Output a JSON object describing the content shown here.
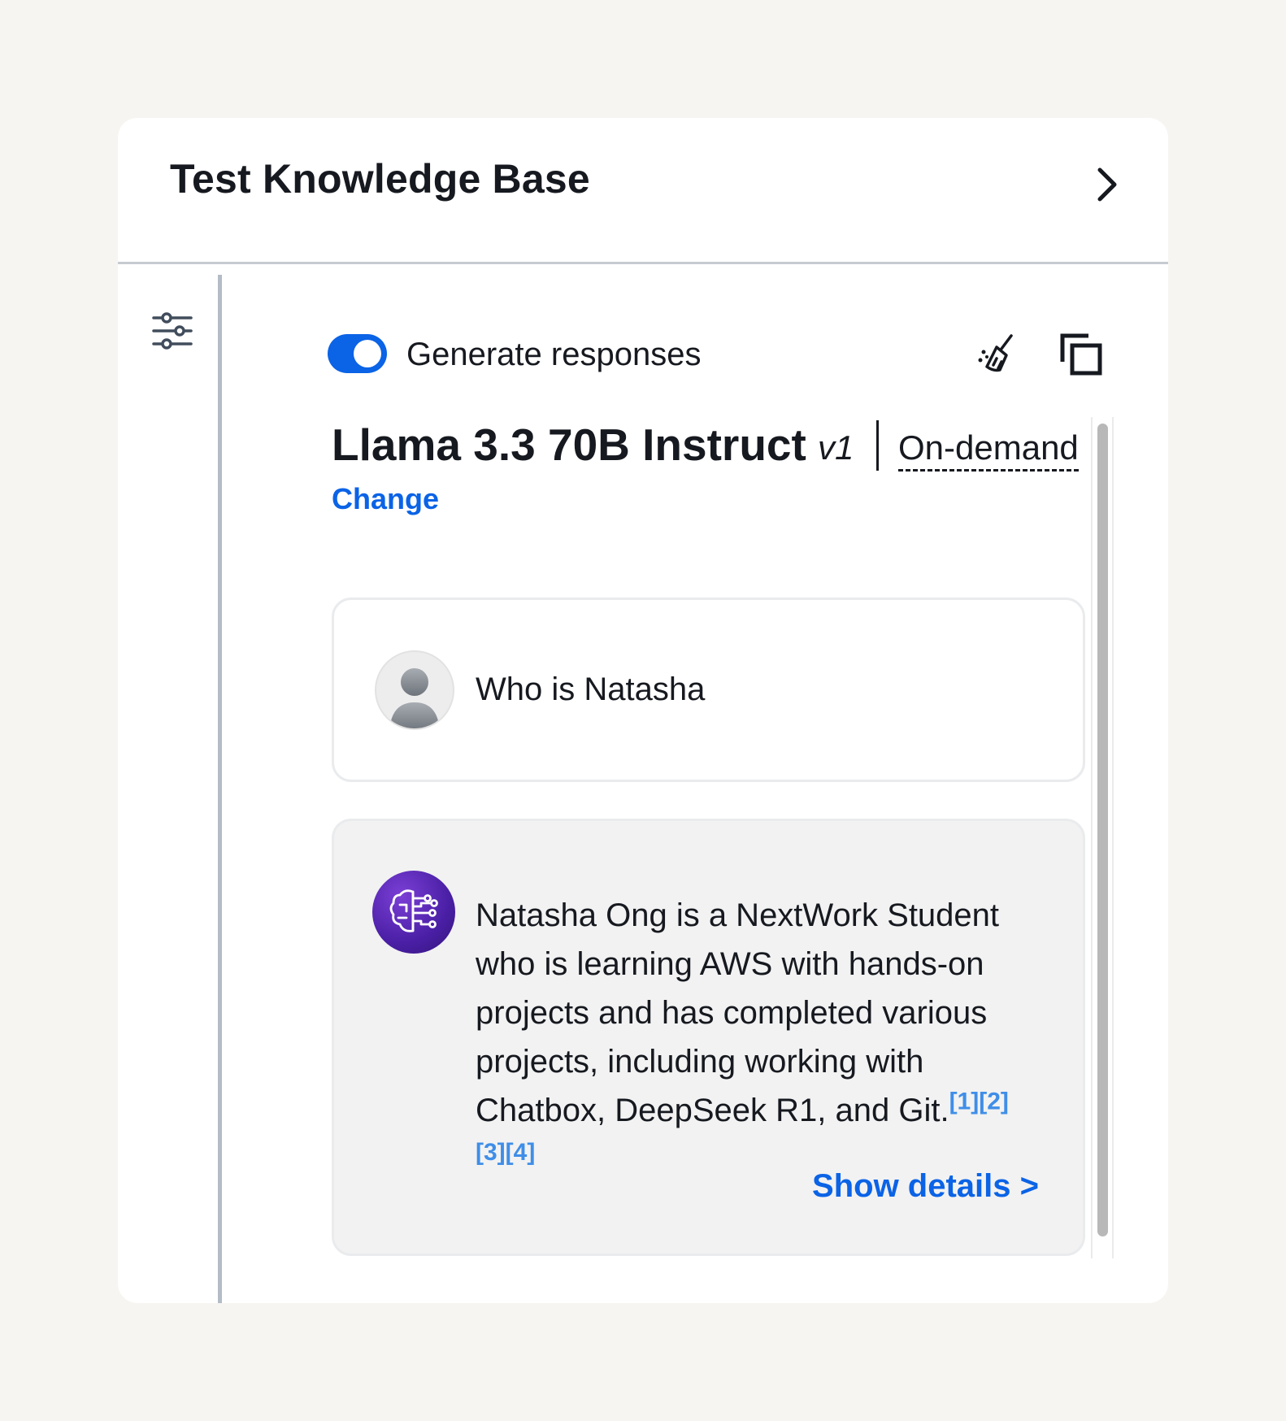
{
  "panel": {
    "title": "Test Knowledge Base"
  },
  "toolbar": {
    "toggle_on": true,
    "toggle_label": "Generate responses"
  },
  "model": {
    "name": "Llama 3.3 70B Instruct",
    "version": "v1",
    "tier": "On-demand",
    "change_label": "Change"
  },
  "conversation": {
    "user_message": "Who is Natasha",
    "bot_message": "Natasha Ong is a NextWork Student who is learning AWS with hands-on projects and has completed various projects, including working with Chatbox, DeepSeek R1, and Git.",
    "citations_inline": "[1][2]",
    "citations_next_line": "[3][4]",
    "show_details_label": "Show details >"
  },
  "colors": {
    "accent": "#0b63e6",
    "citation": "#3f8ee8",
    "bot_bubble": "#f2f2f2",
    "page_bg": "#f7f5f1"
  },
  "icons": [
    "chevron-right-icon",
    "settings-sliders-icon",
    "broom-clear-icon",
    "copy-icon",
    "user-avatar-icon",
    "ai-brain-icon"
  ]
}
